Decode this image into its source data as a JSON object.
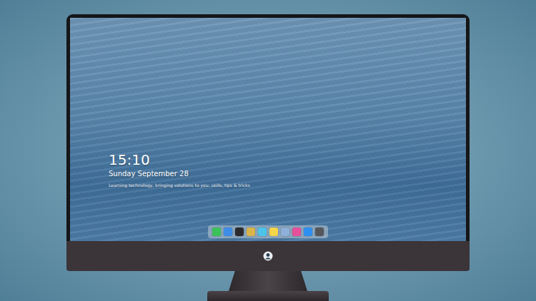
{
  "lock_screen": {
    "time": "15:10",
    "date": "Sunday September 28",
    "caption": "Learning technology, bringing solutions to you: skills, tips & tricks"
  },
  "dock": {
    "items": [
      {
        "color": "#3bc25a"
      },
      {
        "color": "#3e8ee8"
      },
      {
        "color": "#2b2b2e"
      },
      {
        "color": "#d9b44a"
      },
      {
        "color": "#4bc4e8"
      },
      {
        "color": "#f5d54a"
      },
      {
        "color": "#8fb0d8"
      },
      {
        "color": "#e6509a"
      },
      {
        "color": "#2f8ff0"
      },
      {
        "color": "#55575c"
      }
    ]
  }
}
